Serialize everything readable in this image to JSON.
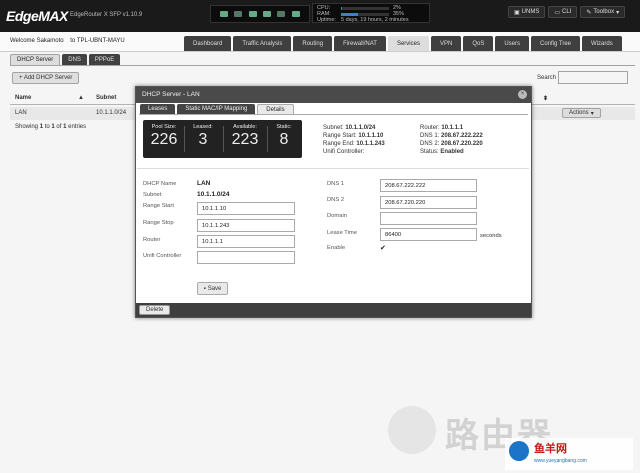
{
  "header": {
    "logo": "EdgeMAX",
    "model": "EdgeRouter X SFP v1.10.9",
    "stats": {
      "cpu_label": "CPU:",
      "cpu_value": "2%",
      "cpu_fraction": 0.02,
      "ram_label": "RAM:",
      "ram_value": "35%",
      "ram_fraction": 0.35,
      "uptime_label": "Uptime:",
      "uptime_value": "5 days, 19 hours, 2 minutes"
    },
    "buttons": {
      "unms": "UNMS",
      "cli": "CLI",
      "toolbox": "Toolbox"
    }
  },
  "subheader": {
    "welcome": "Welcome Sakamoto",
    "to": "to TPL-UBNT-MAYU"
  },
  "nav": {
    "tabs": [
      "Dashboard",
      "Traffic Analysis",
      "Routing",
      "Firewall/NAT",
      "Services",
      "VPN",
      "QoS",
      "Users",
      "Config Tree",
      "Wizards"
    ],
    "active_index": 4
  },
  "services": {
    "tabs": [
      "DHCP Server",
      "DNS",
      "PPPoE"
    ],
    "active_index": 0
  },
  "list": {
    "add_button": "+ Add DHCP Server",
    "search_label": "Search",
    "columns": {
      "name": "Name",
      "subnet": "Subnet"
    },
    "rows": [
      {
        "name": "LAN",
        "subnet": "10.1.1.0/24",
        "action": "Actions"
      }
    ],
    "showing_pre": "Showing",
    "showing_from": "1",
    "showing_to_word": "to",
    "showing_to": "1",
    "showing_of_word": "of",
    "showing_total": "1",
    "showing_post": "entries"
  },
  "modal": {
    "title": "DHCP Server - LAN",
    "close": "×",
    "tabs": [
      "Leases",
      "Static MAC/IP Mapping",
      "Details"
    ],
    "active_tab": 2,
    "stats": {
      "pool_size_label": "Pool Size:",
      "pool_size": "226",
      "leased_label": "Leased:",
      "leased": "3",
      "available_label": "Available:",
      "available": "223",
      "static_label": "Static:",
      "static": "8"
    },
    "summary": {
      "subnet_label": "Subnet:",
      "subnet": "10.1.1.0/24",
      "range_start_label": "Range Start:",
      "range_start": "10.1.1.10",
      "range_end_label": "Range End:",
      "range_end": "10.1.1.243",
      "unifi_label": "Unifi Controller:",
      "router_label": "Router:",
      "router": "10.1.1.1",
      "dns1_label": "DNS 1:",
      "dns1": "208.67.222.222",
      "dns2_label": "DNS 2:",
      "dns2": "208.67.220.220",
      "status_label": "Status:",
      "status": "Enabled"
    },
    "form": {
      "name_label": "DHCP Name",
      "name": "LAN",
      "subnet_label": "Subnet",
      "subnet": "10.1.1.0/24",
      "range_start_label": "Range Start",
      "range_start": "10.1.1.10",
      "range_stop_label": "Range Stop",
      "range_stop": "10.1.1.243",
      "router_label": "Router",
      "router": "10.1.1.1",
      "unifi_label": "Unifi Controller",
      "unifi": "",
      "dns1_label": "DNS 1",
      "dns1": "208.67.222.222",
      "dns2_label": "DNS 2",
      "dns2": "208.67.220.220",
      "domain_label": "Domain",
      "domain": "",
      "lease_label": "Lease Time",
      "lease": "86400",
      "lease_unit": "seconds",
      "enable_label": "Enable",
      "enable_mark": "✔"
    },
    "save_button": "Save",
    "delete_button": "Delete"
  },
  "watermark": {
    "text": "路由器",
    "cn": "鱼羊网",
    "url": "www.yueyangbang.com"
  }
}
